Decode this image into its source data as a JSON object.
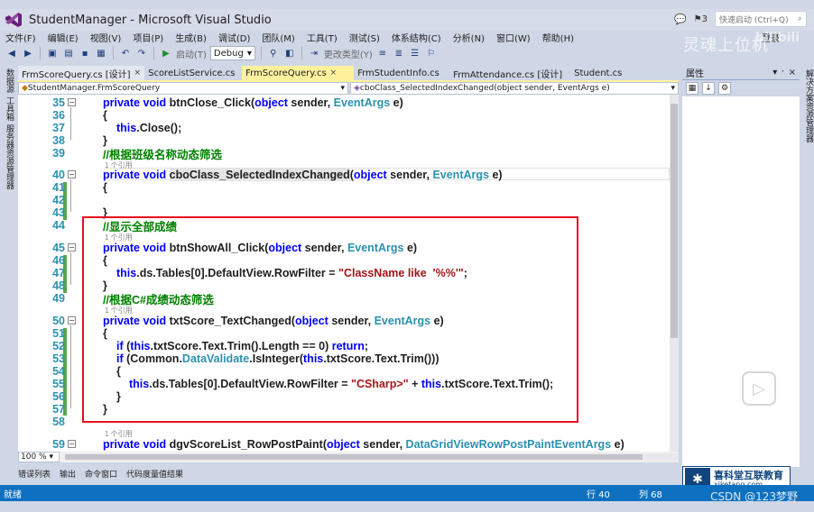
{
  "window": {
    "title": "StudentManager - Microsoft Visual Studio",
    "quick_launch": "快速启动 (Ctrl+Q)",
    "notifications": "3",
    "login": "登录"
  },
  "menu": [
    "文件(F)",
    "编辑(E)",
    "视图(V)",
    "项目(P)",
    "生成(B)",
    "调试(D)",
    "团队(M)",
    "工具(T)",
    "测试(S)",
    "体系结构(C)",
    "分析(N)",
    "窗口(W)",
    "帮助(H)"
  ],
  "toolbar": {
    "start_label": "启动(T)",
    "config": "Debug",
    "stepping": "更改类型(Y)"
  },
  "watermark": {
    "text": "灵魂上位机",
    "bili": "bilibili"
  },
  "left_strip": {
    "tab1": "数据源",
    "tab2": "工具箱",
    "tab3": "服务器资源管理器"
  },
  "right_strip": {
    "tab1": "解决方案资源管理器"
  },
  "tabs": [
    {
      "label": "FrmScoreQuery.cs [设计]",
      "close": "×",
      "state": "pinned"
    },
    {
      "label": "ScoreListService.cs",
      "close": "",
      "state": ""
    },
    {
      "label": "FrmScoreQuery.cs",
      "close": "×",
      "state": "active"
    },
    {
      "label": "FrmStudentInfo.cs",
      "close": "",
      "state": ""
    },
    {
      "label": "FrmAttendance.cs [设计]",
      "close": "",
      "state": ""
    },
    {
      "label": "Student.cs",
      "close": "",
      "state": ""
    }
  ],
  "nav": {
    "class_dd": "StudentManager.FrmScoreQuery",
    "member_dd": "cboClass_SelectedIndexChanged(object sender, EventArgs e)"
  },
  "code": {
    "l35": {
      "n": "35",
      "a": "private void ",
      "b": "btnClose_Click",
      "c": "(",
      "d": "object",
      "e": " sender, ",
      "f": "EventArgs",
      "g": " e)"
    },
    "l36": {
      "n": "36",
      "t": "{"
    },
    "l37": {
      "n": "37",
      "a": "this",
      "b": ".Close();"
    },
    "l38": {
      "n": "38",
      "t": "}"
    },
    "l39": {
      "n": "39",
      "t": "//根据班级名称动态筛选"
    },
    "ref1": "1 个引用",
    "l40": {
      "n": "40",
      "a": "private void ",
      "b": "cboClass_SelectedIndexChanged",
      "c": "(",
      "d": "object",
      "e": " sender, ",
      "f": "EventArgs",
      "g": " e)"
    },
    "l41": {
      "n": "41",
      "t": "{"
    },
    "l42": {
      "n": "42",
      "t": ""
    },
    "l43": {
      "n": "43",
      "t": "}"
    },
    "l44": {
      "n": "44",
      "t": "//显示全部成绩"
    },
    "ref2": "1 个引用",
    "l45": {
      "n": "45",
      "a": "private void ",
      "b": "btnShowAll_Click",
      "c": "(",
      "d": "object",
      "e": " sender, ",
      "f": "EventArgs",
      "g": " e)"
    },
    "l46": {
      "n": "46",
      "t": "{"
    },
    "l47": {
      "n": "47",
      "a": "this",
      "b": ".ds.Tables[0].DefaultView.RowFilter = ",
      "c": "\"ClassName like  '%%'\"",
      "d": ";"
    },
    "l48": {
      "n": "48",
      "t": "}"
    },
    "l49": {
      "n": "49",
      "t": "//根据C#成绩动态筛选"
    },
    "ref3": "1 个引用",
    "l50": {
      "n": "50",
      "a": "private void ",
      "b": "txtScore_TextChanged",
      "c": "(",
      "d": "object",
      "e": " sender, ",
      "f": "EventArgs",
      "g": " e)"
    },
    "l51": {
      "n": "51",
      "t": "{"
    },
    "l52": {
      "n": "52",
      "a": "if",
      "b": " (",
      "c": "this",
      "d": ".txtScore.Text.Trim().Length == 0) ",
      "e": "return",
      "f": ";"
    },
    "l53": {
      "n": "53",
      "a": "if",
      "b": " (Common.",
      "c": "DataValidate",
      "d": ".IsInteger(",
      "e": "this",
      "f": ".txtScore.Text.Trim()))"
    },
    "l54": {
      "n": "54",
      "t": "{"
    },
    "l55": {
      "n": "55",
      "a": "this",
      "b": ".ds.Tables[0].DefaultView.RowFilter = ",
      "c": "\"CSharp>\"",
      "d": " + ",
      "e": "this",
      "f": ".txtScore.Text.Trim();"
    },
    "l56": {
      "n": "56",
      "t": "}"
    },
    "l57": {
      "n": "57",
      "t": "}"
    },
    "l58": {
      "n": "58",
      "t": ""
    },
    "ref4": "1 个引用",
    "l59": {
      "n": "59",
      "a": "private void ",
      "b": "dgvScoreList_RowPostPaint",
      "c": "(",
      "d": "object",
      "e": " sender, ",
      "f": "DataGridViewRowPostPaintEventArgs",
      "g": " e)"
    }
  },
  "zoom": "100 %",
  "bottom_tabs": [
    "错误列表",
    "输出",
    "命令窗口",
    "代码度量值结果"
  ],
  "status": {
    "ready": "就绪",
    "line": "行 40",
    "col": "列 68"
  },
  "properties": {
    "title": "属性",
    "pin": "▾ ᛫ ×"
  },
  "logo": {
    "cn": "喜科堂互联教育",
    "url": "xiketang.com",
    "mark": "✱"
  },
  "csdn": "CSDN @123梦野"
}
